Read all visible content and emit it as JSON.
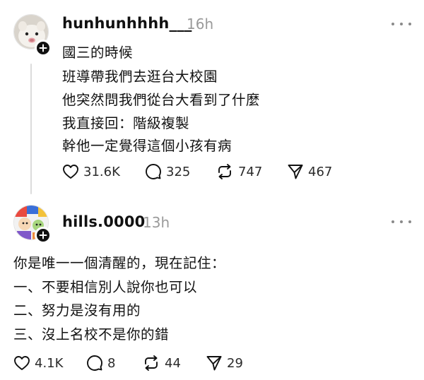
{
  "posts": [
    {
      "username": "hunhunhhhh___",
      "timestamp": "16h",
      "avatar_icon": "plush-toy-avatar",
      "lines": [
        "國三的時候",
        "班導帶我們去逛台大校園",
        "他突然問我們從台大看到了什麼",
        "我直接回：階級複製",
        "幹他一定覺得這個小孩有病"
      ],
      "likes": "31.6K",
      "replies": "325",
      "reposts": "747",
      "shares": "467"
    },
    {
      "username": "hills.0000",
      "timestamp": "13h",
      "avatar_icon": "colorful-illustration-avatar",
      "lines": [
        "你是唯一一個清醒的，現在記住：",
        "一、不要相信別人說你也可以",
        "二、努力是沒有用的",
        "三、沒上名校不是你的錯"
      ],
      "likes": "4.1K",
      "replies": "8",
      "reposts": "44",
      "shares": "29"
    }
  ],
  "colors": {
    "text": "#111111",
    "muted": "#9a9a9a",
    "thread_line": "#dcdcdc"
  }
}
